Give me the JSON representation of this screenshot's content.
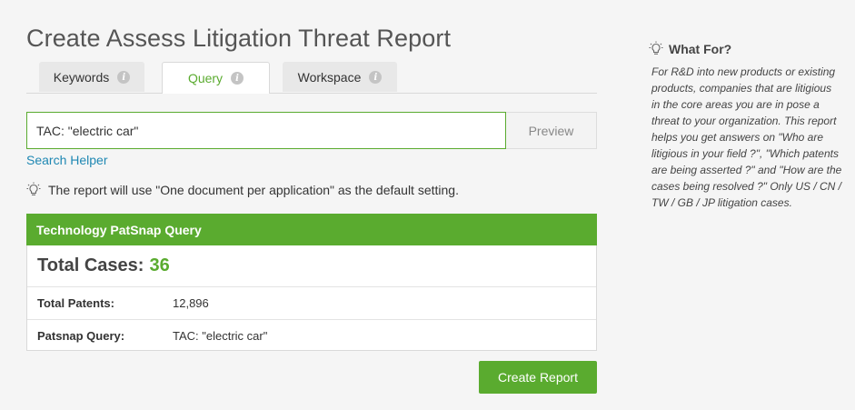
{
  "page": {
    "title": "Create Assess Litigation Threat Report"
  },
  "tabs": [
    {
      "label": "Keywords",
      "active": false,
      "icon": "info-icon"
    },
    {
      "label": "Query",
      "active": true,
      "icon": "info-icon"
    },
    {
      "label": "Workspace",
      "active": false,
      "icon": "info-icon"
    }
  ],
  "query": {
    "value": "TAC: \"electric car\"",
    "preview_label": "Preview"
  },
  "search_helper": "Search Helper",
  "note": {
    "icon": "lightbulb-icon",
    "text": "The report will use \"One document per application\" as the default setting."
  },
  "result": {
    "header": "Technology PatSnap Query",
    "total_cases_label": "Total Cases:",
    "total_cases_value": "36",
    "rows": [
      {
        "label": "Total Patents:",
        "value": "12,896"
      },
      {
        "label": "Patsnap Query:",
        "value": "TAC: \"electric car\""
      }
    ]
  },
  "create_button": "Create Report",
  "sidebar": {
    "icon": "lightbulb-icon",
    "heading": "What For?",
    "text": "For R&D into new products or existing products, companies that are litigious in the core areas you are in pose a threat to your organization. This report helps you get answers on \"Who are litigious in your field ?\", \"Which patents are being asserted ?\" and \"How are the cases being resolved ?\" Only US / CN / TW / GB / JP litigation cases."
  },
  "colors": {
    "accent": "#5aab2f",
    "link": "#1f88b3"
  }
}
